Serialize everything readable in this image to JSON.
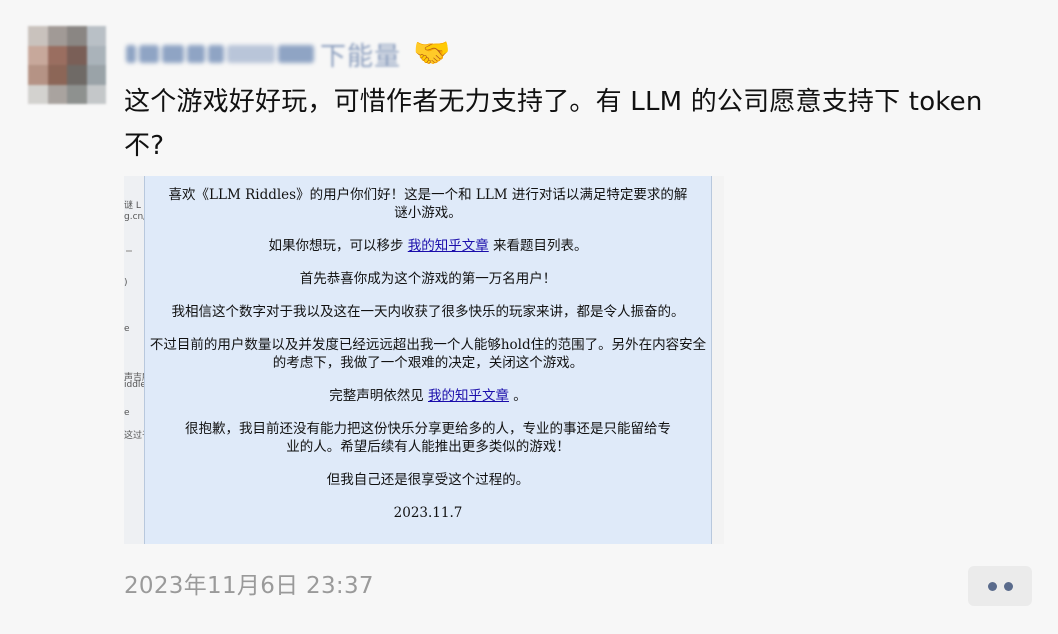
{
  "author": {
    "name_visible": "下能量",
    "emoji": "🤝"
  },
  "post": {
    "text": "这个游戏好好玩，可惜作者无力支持了。有 LLM 的公司愿意支持下 token 不?",
    "timestamp": "2023年11月6日 23:37"
  },
  "screenshot": {
    "left_fragments": [
      "谜 L",
      "g.cn/",
      ")",
      "e",
      "声吉所",
      "iddle",
      "e",
      "这过于"
    ],
    "lines": [
      "喜欢《LLM Riddles》的用户你们好！这是一个和 LLM 进行对话以满足特定要求的解谜小游戏。",
      "首先恭喜你成为这个游戏的第一万名用户！",
      "我相信这个数字对于我以及这在一天内收获了很多快乐的玩家来讲，都是令人振奋的。",
      "不过目前的用户数量以及并发度已经远远超出我一个人能够hold住的范围了。另外在内容安全的考虑下，我做了一个艰难的决定，关闭这个游戏。",
      "很抱歉，我目前还没有能力把这份快乐分享更给多的人，专业的事还是只能留给专业的人。希望后续有人能推出更多类似的游戏！",
      "但我自己还是很享受这个过程的。",
      "2023.11.7"
    ],
    "line_play_prefix": "如果你想玩，可以移步",
    "line_play_link": "我的知乎文章",
    "line_play_suffix": "来看题目列表。",
    "line_full_prefix": "完整声明依然见",
    "line_full_link": "我的知乎文章",
    "line_full_suffix": "。"
  },
  "colors": {
    "background": "#f7f7f7",
    "link": "#1a0dab",
    "panel": "#dfeaf9",
    "timestamp": "#9a9a9a",
    "more_dots": "#5a6b8c"
  },
  "icons": {
    "reaction": "handshake-icon",
    "more": "more-dots-icon"
  }
}
